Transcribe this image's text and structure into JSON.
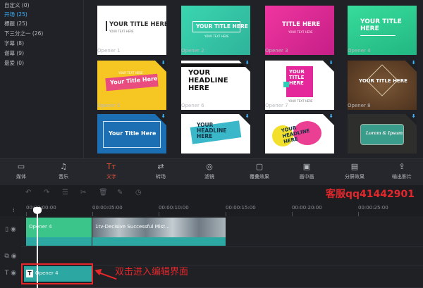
{
  "sidebar": {
    "categories": [
      {
        "label": "自定义 (0)",
        "active": false
      },
      {
        "label": "开场 (25)",
        "active": true
      },
      {
        "label": "標題 (25)",
        "active": false
      },
      {
        "label": "下三分之一 (26)",
        "active": false
      },
      {
        "label": "字幕 (8)",
        "active": false
      },
      {
        "label": "谢幕 (9)",
        "active": false
      },
      {
        "label": "最爱 (0)",
        "active": false
      }
    ]
  },
  "tiles": [
    {
      "label": "Opener 1",
      "text": "YOUR TITLE HERE",
      "bg": "#ffffff",
      "fg": "#333333"
    },
    {
      "label": "Opener 2",
      "text": "YOUR TITLE HERE",
      "bg": "#35c7a2",
      "fg": "#ffffff"
    },
    {
      "label": "Opener 3",
      "text": "TITLE HERE",
      "bg": "#e4279a",
      "fg": "#ffffff"
    },
    {
      "label": "Opener 4",
      "text": "YOUR TITLE HERE",
      "bg": "#2ecc8c",
      "fg": "#ffffff"
    },
    {
      "label": "Opener 5",
      "text": "Your Title Here",
      "bg": "#f6c722",
      "fg": "#ffffff"
    },
    {
      "label": "Opener 6",
      "text": "YOUR HEADLINE HERE",
      "bg": "#ffffff",
      "fg": "#111111"
    },
    {
      "label": "Opener 7",
      "text": "YOUR TITLE HERE",
      "bg": "#ffffff",
      "fg": "#ffffff"
    },
    {
      "label": "Opener 8",
      "text": "YOUR TITLE HERE",
      "bg": "#6b4a2c",
      "fg": "#ffffff"
    },
    {
      "label": "",
      "text": "Your Title Here",
      "bg": "#1c6fb3",
      "fg": "#ffffff"
    },
    {
      "label": "",
      "text": "YOUR HEADLINE HERE",
      "bg": "#ffffff",
      "fg": "#113344"
    },
    {
      "label": "",
      "text": "YOUR HEADLINE HERE",
      "bg": "#ffffff",
      "fg": "#113344"
    },
    {
      "label": "",
      "text": "Lorem & Ipsum",
      "bg": "#2e2f2c",
      "fg": "#e8e8e8"
    }
  ],
  "tile_small_text": {
    "your_text_here": "YOUR TEXT HERE"
  },
  "toolbar": {
    "items": [
      {
        "label": "媒体",
        "icon": "▭",
        "active": false
      },
      {
        "label": "音乐",
        "icon": "♫",
        "active": false
      },
      {
        "label": "文字",
        "icon": "Tт",
        "active": true
      },
      {
        "label": "转场",
        "icon": "⇄",
        "active": false
      },
      {
        "label": "滤镜",
        "icon": "◎",
        "active": false
      },
      {
        "label": "覆叠效果",
        "icon": "▢",
        "active": false
      },
      {
        "label": "画中画",
        "icon": "▣",
        "active": false
      },
      {
        "label": "分屏效果",
        "icon": "▤",
        "active": false
      },
      {
        "label": "输出影片",
        "icon": "⇪",
        "active": false
      }
    ]
  },
  "watermark": "客服qq41442901",
  "ruler": {
    "ticks": [
      "00:00:00:00",
      "00:00:05:00",
      "00:00:10:00",
      "00:00:15:00",
      "00:00:20:00",
      "00:00:25:00"
    ]
  },
  "clips": {
    "video1": "Opener 4",
    "video2": "1tv-Decisive Successful Mist...",
    "text": "Opener 4",
    "text_icon": "T"
  },
  "annotation": "双击进入编辑界面",
  "colors": {
    "accent": "#3fb6ff",
    "active_tool": "#e6553a",
    "clip_green": "#36b7a0",
    "annotation_red": "#e3272b"
  }
}
